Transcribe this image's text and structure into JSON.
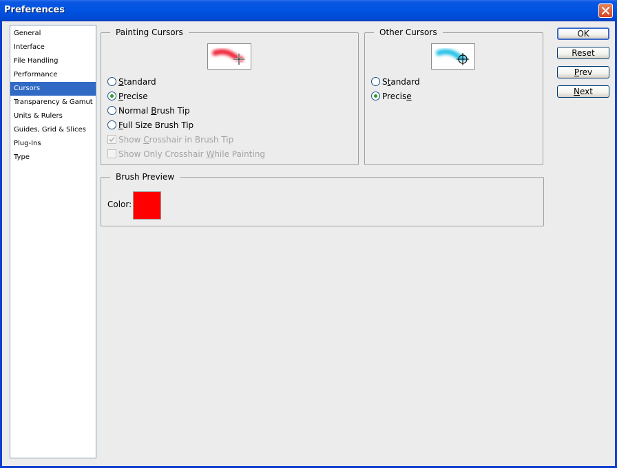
{
  "window": {
    "title": "Preferences"
  },
  "categories": [
    {
      "label": "General"
    },
    {
      "label": "Interface"
    },
    {
      "label": "File Handling"
    },
    {
      "label": "Performance"
    },
    {
      "label": "Cursors",
      "selected": true
    },
    {
      "label": "Transparency & Gamut"
    },
    {
      "label": "Units & Rulers"
    },
    {
      "label": "Guides, Grid & Slices"
    },
    {
      "label": "Plug-Ins"
    },
    {
      "label": "Type"
    }
  ],
  "painting_cursors": {
    "title": "Painting Cursors",
    "standard": {
      "pre": "",
      "key": "S",
      "post": "tandard"
    },
    "precise": {
      "pre": "",
      "key": "P",
      "post": "recise"
    },
    "normal_brush_tip": {
      "pre": "Normal ",
      "key": "B",
      "post": "rush Tip"
    },
    "full_size_brush_tip": {
      "pre": "",
      "key": "F",
      "post": "ull Size Brush Tip"
    },
    "show_crosshair": {
      "pre": "Show ",
      "key": "C",
      "post": "rosshair in Brush Tip"
    },
    "show_only_crosshair": {
      "pre": "Show Only Crosshair ",
      "key": "W",
      "post": "hile Painting"
    },
    "brush_color": "#ee2b3e"
  },
  "other_cursors": {
    "title": "Other Cursors",
    "standard": {
      "pre": "S",
      "key": "t",
      "post": "andard"
    },
    "precise": {
      "pre": "Precis",
      "key": "e",
      "post": ""
    },
    "brush_color": "#29c3e8"
  },
  "brush_preview": {
    "title": "Brush Preview",
    "color_label": "Color:",
    "color": "#ff0000"
  },
  "buttons": {
    "ok": {
      "pre": "",
      "key": "",
      "post": "OK"
    },
    "reset": {
      "pre": "Reset",
      "key": "",
      "post": ""
    },
    "prev": {
      "pre": "",
      "key": "P",
      "post": "rev"
    },
    "next": {
      "pre": "",
      "key": "N",
      "post": "ext"
    }
  }
}
